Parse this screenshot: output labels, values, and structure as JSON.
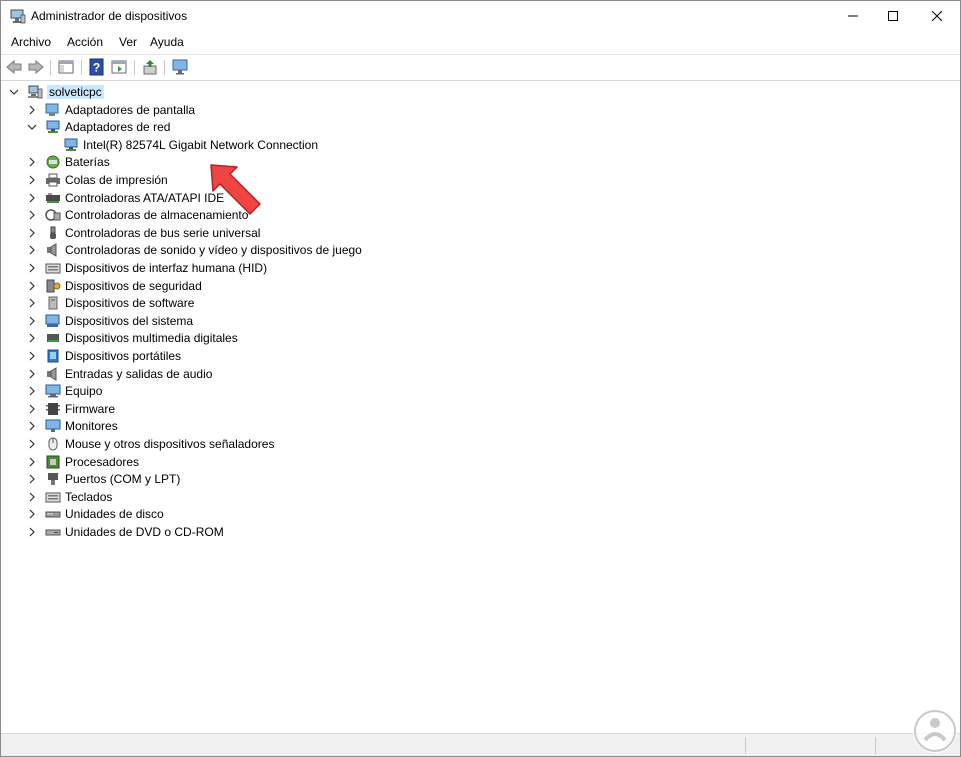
{
  "window": {
    "title": "Administrador de dispositivos"
  },
  "menu": [
    "Archivo",
    "Acción",
    "Ver",
    "Ayuda"
  ],
  "tree": {
    "root": "solveticpc",
    "expanded_category": {
      "label": "Adaptadores de red",
      "child": "Intel(R) 82574L Gigabit Network Connection"
    },
    "categories": [
      {
        "label": "Adaptadores de pantalla",
        "icon": "display-adapter-icon"
      },
      {
        "label": "Adaptadores de red",
        "icon": "network-adapter-icon"
      },
      {
        "label": "Baterías",
        "icon": "battery-icon"
      },
      {
        "label": "Colas de impresión",
        "icon": "printer-icon"
      },
      {
        "label": "Controladoras ATA/ATAPI IDE",
        "icon": "ide-controller-icon"
      },
      {
        "label": "Controladoras de almacenamiento",
        "icon": "storage-controller-icon"
      },
      {
        "label": "Controladoras de bus serie universal",
        "icon": "usb-icon"
      },
      {
        "label": "Controladoras de sonido y vídeo y dispositivos de juego",
        "icon": "speaker-icon"
      },
      {
        "label": "Dispositivos de interfaz humana (HID)",
        "icon": "keyboard-icon"
      },
      {
        "label": "Dispositivos de seguridad",
        "icon": "security-key-icon"
      },
      {
        "label": "Dispositivos de software",
        "icon": "software-device-icon"
      },
      {
        "label": "Dispositivos del sistema",
        "icon": "system-device-icon"
      },
      {
        "label": "Dispositivos multimedia digitales",
        "icon": "multimedia-icon"
      },
      {
        "label": "Dispositivos portátiles",
        "icon": "portable-device-icon"
      },
      {
        "label": "Entradas y salidas de audio",
        "icon": "speaker-icon"
      },
      {
        "label": "Equipo",
        "icon": "computer-icon"
      },
      {
        "label": "Firmware",
        "icon": "firmware-icon"
      },
      {
        "label": "Monitores",
        "icon": "monitor-icon"
      },
      {
        "label": "Mouse y otros dispositivos señaladores",
        "icon": "mouse-icon"
      },
      {
        "label": "Procesadores",
        "icon": "processor-icon"
      },
      {
        "label": "Puertos (COM y LPT)",
        "icon": "port-icon"
      },
      {
        "label": "Teclados",
        "icon": "keyboard-icon"
      },
      {
        "label": "Unidades de disco",
        "icon": "disk-drive-icon"
      },
      {
        "label": "Unidades de DVD o CD-ROM",
        "icon": "dvd-drive-icon"
      }
    ]
  },
  "colors": {
    "selection": "#cce8ff",
    "pointer": "#ee4444",
    "accent": "#1f6fc5"
  }
}
